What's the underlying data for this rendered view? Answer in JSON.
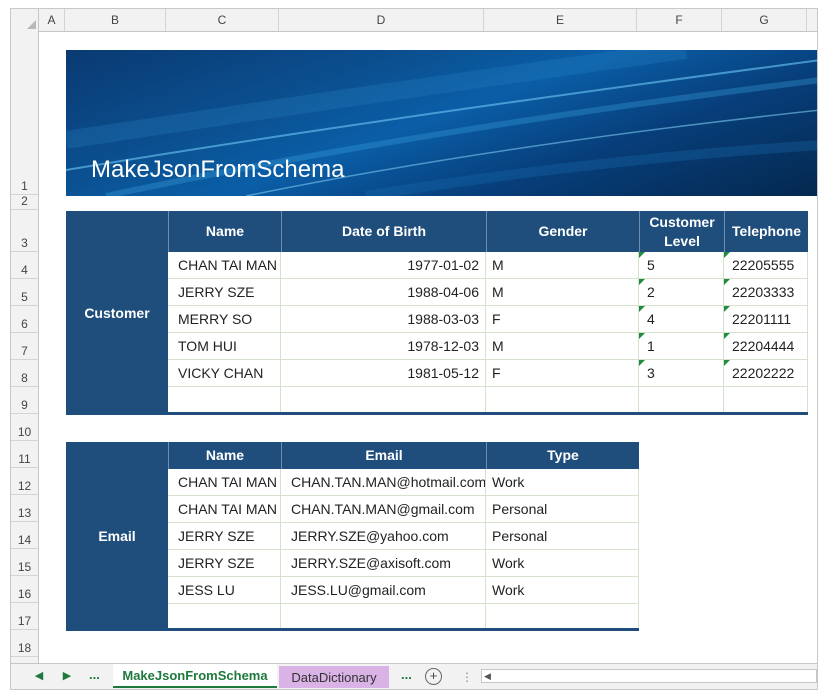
{
  "columns": [
    "A",
    "B",
    "C",
    "D",
    "E",
    "F",
    "G"
  ],
  "rows": [
    "1",
    "2",
    "3",
    "4",
    "5",
    "6",
    "7",
    "8",
    "9",
    "10",
    "11",
    "12",
    "13",
    "14",
    "15",
    "16",
    "17",
    "18"
  ],
  "banner": {
    "title": "MakeJsonFromSchema"
  },
  "customer": {
    "label": "Customer",
    "headers": [
      "Name",
      "Date of Birth",
      "Gender",
      "Customer Level",
      "Telephone"
    ],
    "rows": [
      [
        "CHAN TAI MAN",
        "1977-01-02",
        "M",
        "5",
        "22205555"
      ],
      [
        "JERRY SZE",
        "1988-04-06",
        "M",
        "2",
        "22203333"
      ],
      [
        "MERRY SO",
        "1988-03-03",
        "F",
        "4",
        "22201111"
      ],
      [
        "TOM HUI",
        "1978-12-03",
        "M",
        "1",
        "22204444"
      ],
      [
        "VICKY CHAN",
        "1981-05-12",
        "F",
        "3",
        "22202222"
      ],
      [
        "",
        "",
        "",
        "",
        ""
      ]
    ]
  },
  "email": {
    "label": "Email",
    "headers": [
      "Name",
      "Email",
      "Type"
    ],
    "rows": [
      [
        "CHAN TAI MAN",
        "CHAN.TAN.MAN@hotmail.com",
        "Work"
      ],
      [
        "CHAN TAI MAN",
        "CHAN.TAN.MAN@gmail.com",
        "Personal"
      ],
      [
        "JERRY SZE",
        "JERRY.SZE@yahoo.com",
        "Personal"
      ],
      [
        "JERRY SZE",
        "JERRY.SZE@axisoft.com",
        "Work"
      ],
      [
        "JESS LU",
        "JESS.LU@gmail.com",
        "Work"
      ],
      [
        "",
        "",
        ""
      ]
    ]
  },
  "tabs": {
    "nav_prev": "◀",
    "nav_next": "▶",
    "ellipsis": "...",
    "active": "MakeJsonFromSchema",
    "second": "DataDictionary",
    "add": "+",
    "separator": "⋮",
    "scroll_left": "◀"
  },
  "colors": {
    "header_blue": "#1f4e7d",
    "tab_green": "#1e7a3c",
    "tab_purple": "#d9b3e6"
  }
}
